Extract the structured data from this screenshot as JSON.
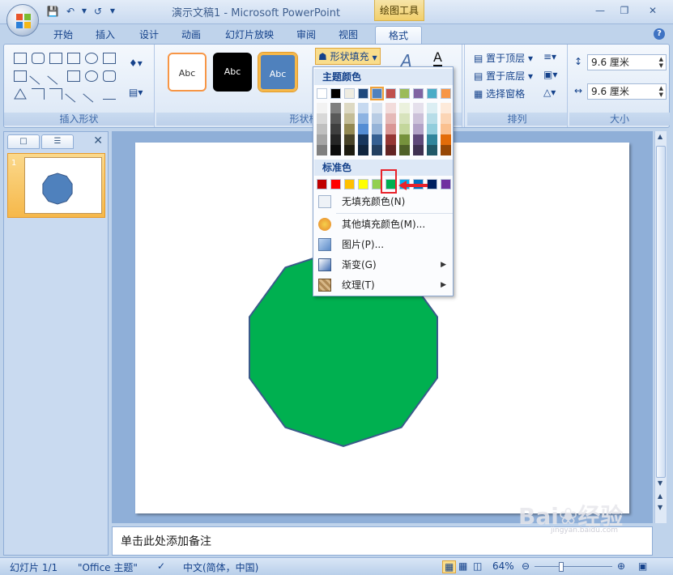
{
  "window": {
    "title": "演示文稿1 - Microsoft PowerPoint",
    "context_tool": "绘图工具"
  },
  "tabs": [
    "开始",
    "插入",
    "设计",
    "动画",
    "幻灯片放映",
    "审阅",
    "视图",
    "格式"
  ],
  "active_tab": "格式",
  "ribbon": {
    "insert_shapes_label": "插入形状",
    "shape_styles_label": "形状样式",
    "style_sample_text": "Abc",
    "shape_fill_button": "形状填充",
    "arrange_label": "排列",
    "bring_to_front": "置于顶层",
    "send_to_back": "置于底层",
    "selection_pane": "选择窗格",
    "size_label": "大小",
    "height_value": "9.6 厘米",
    "width_value": "9.6 厘米"
  },
  "dropdown": {
    "theme_colors_header": "主题颜色",
    "standard_colors_header": "标准色",
    "no_fill": "无填充颜色(N)",
    "more_colors": "其他填充颜色(M)...",
    "picture": "图片(P)...",
    "gradient": "渐变(G)",
    "texture": "纹理(T)",
    "theme_top_row": [
      "#ffffff",
      "#000000",
      "#eeece1",
      "#1f497d",
      "#4f81bd",
      "#c0504d",
      "#9bbb59",
      "#8064a2",
      "#4bacc6",
      "#f79646"
    ],
    "theme_columns": [
      [
        "#f2f2f2",
        "#d8d8d8",
        "#bfbfbf",
        "#a5a5a5",
        "#7f7f7f"
      ],
      [
        "#7f7f7f",
        "#595959",
        "#3f3f3f",
        "#262626",
        "#0c0c0c"
      ],
      [
        "#ddd9c3",
        "#c4bd97",
        "#938953",
        "#494429",
        "#1d1b10"
      ],
      [
        "#c6d9f0",
        "#8db3e2",
        "#548dd4",
        "#17365d",
        "#0f243e"
      ],
      [
        "#dbe5f1",
        "#b8cce4",
        "#95b3d7",
        "#366092",
        "#244061"
      ],
      [
        "#f2dcdb",
        "#e5b9b7",
        "#d99694",
        "#953734",
        "#632423"
      ],
      [
        "#ebf1dd",
        "#d7e3bc",
        "#c3d69b",
        "#76923c",
        "#4f6128"
      ],
      [
        "#e5e0ec",
        "#ccc1d9",
        "#b2a2c7",
        "#5f497a",
        "#3f3151"
      ],
      [
        "#dbeef3",
        "#b7dde8",
        "#92cddc",
        "#31859b",
        "#205867"
      ],
      [
        "#fdeada",
        "#fbd5b5",
        "#fac08f",
        "#e36c09",
        "#974806"
      ]
    ],
    "standard_colors": [
      "#c00000",
      "#ff0000",
      "#ffc000",
      "#ffff00",
      "#92d050",
      "#00b050",
      "#00b0f0",
      "#0070c0",
      "#002060",
      "#7030a0"
    ],
    "selected_standard_index": 5
  },
  "left_pane": {
    "slide_number": "1"
  },
  "slide": {
    "shape_fill": "#00b050",
    "shape_stroke": "#3a5a8a",
    "thumbnail_fill": "#4f81bd"
  },
  "notes_placeholder": "单击此处添加备注",
  "status": {
    "slide_info": "幻灯片 1/1",
    "theme": "\"Office 主题\"",
    "language": "中文(简体，中国)",
    "zoom": "64%"
  },
  "watermark": {
    "brand": "Bai",
    "brand_cn": "经验",
    "url": "jingyan.baidu.com"
  }
}
